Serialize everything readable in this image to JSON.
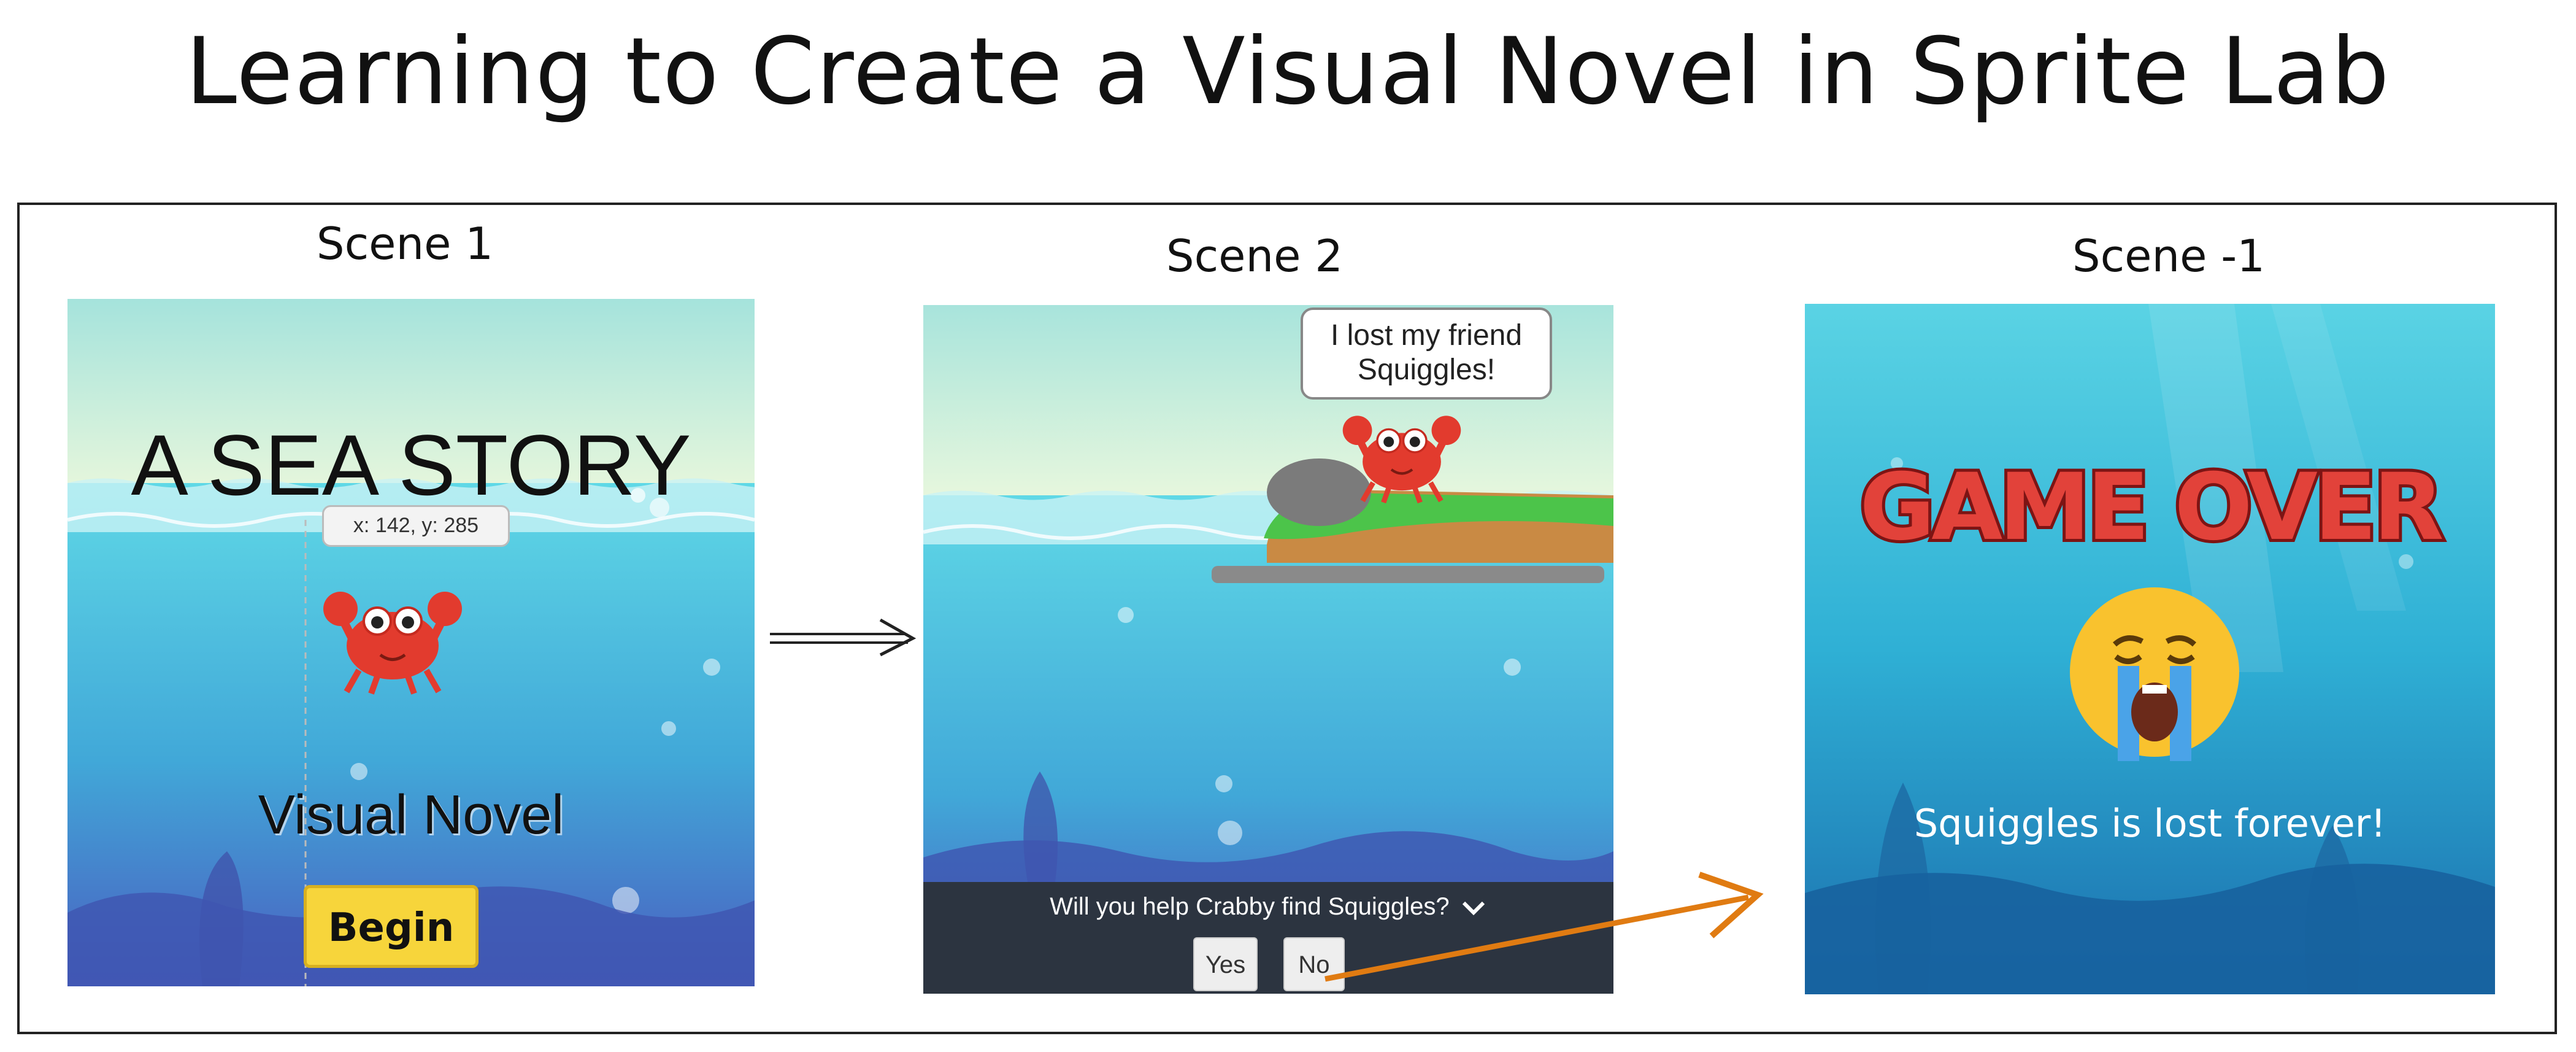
{
  "title": "Learning to Create a Visual Novel in Sprite Lab",
  "scenes": [
    {
      "label": "Scene 1",
      "title": "A SEA STORY",
      "coordinate_readout": "x: 142, y: 285",
      "subtitle": "Visual Novel",
      "button": "Begin"
    },
    {
      "label": "Scene 2",
      "speech": [
        "I lost my friend",
        "Squiggles!"
      ],
      "prompt": "Will you help Crabby find Squiggles?",
      "choices": [
        "Yes",
        "No"
      ]
    },
    {
      "label": "Scene -1",
      "title": "GAME OVER",
      "message": "Squiggles is lost forever!"
    }
  ],
  "icons": {
    "crab": "crab-sprite",
    "emoji": "crying-face",
    "arrow": "right-arrow",
    "chevron": "chevron-down"
  },
  "colors": {
    "sea_top": "#5fd8e6",
    "sea_bottom": "#4a5ec0",
    "begin_button": "#f7d53b",
    "prompt_bar": "#2c3440",
    "game_over_red": "#e2423a",
    "arrow_orange": "#e07b12"
  }
}
